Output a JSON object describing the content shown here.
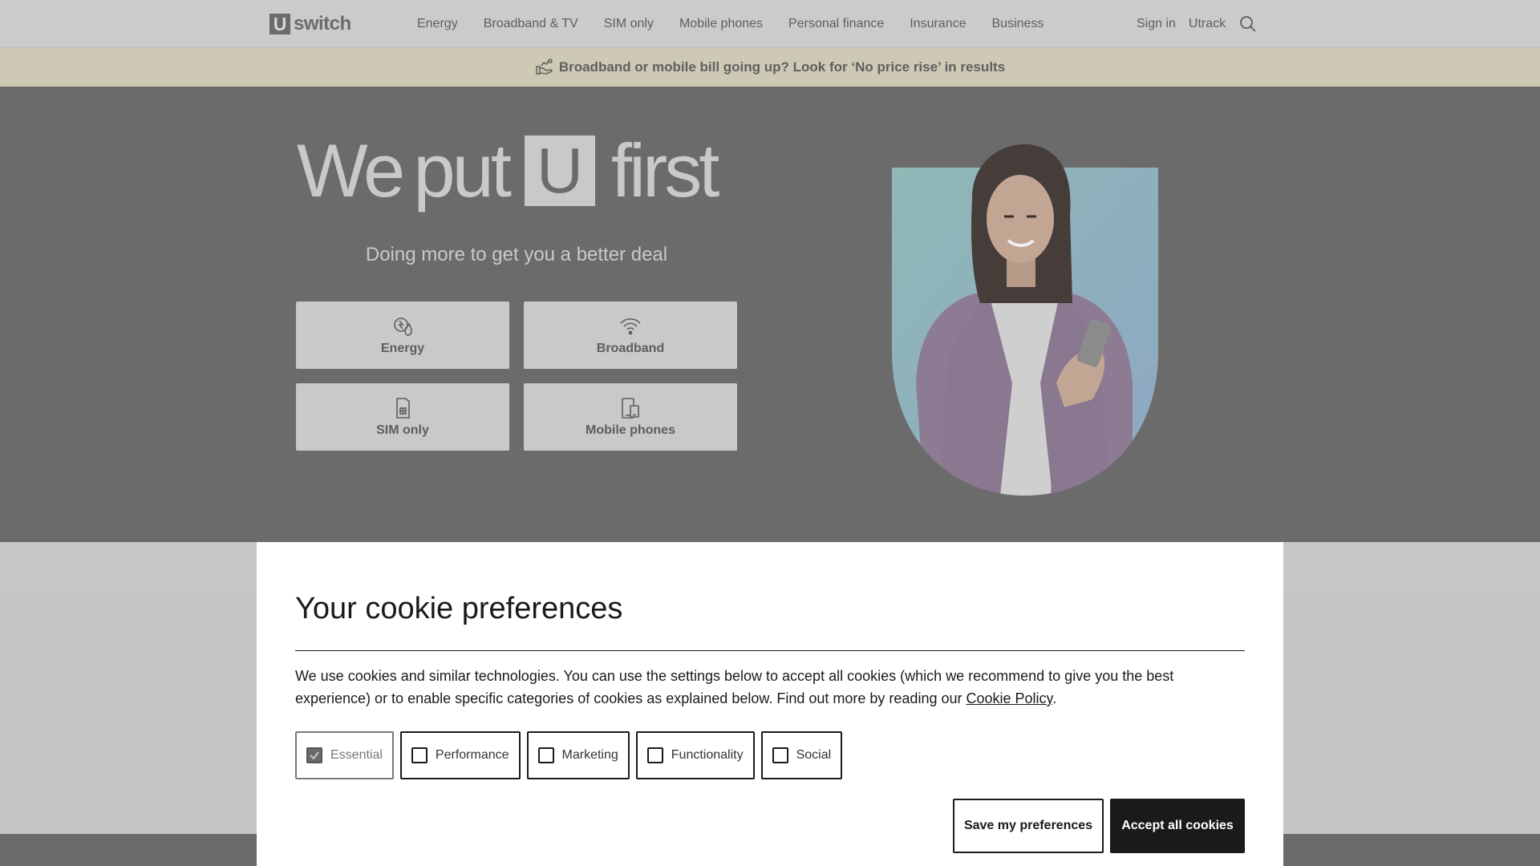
{
  "header": {
    "logo_box": "U",
    "logo_text": "switch",
    "nav": [
      "Energy",
      "Broadband & TV",
      "SIM only",
      "Mobile phones",
      "Personal finance",
      "Insurance",
      "Business"
    ],
    "sign_in": "Sign in",
    "utrack": "Utrack",
    "search_icon": "search-icon"
  },
  "banner": {
    "icon": "price-rise-hand-icon",
    "text": "Broadband or mobile bill going up? Look for ‘No price rise’ in results"
  },
  "hero": {
    "title_part1": "We",
    "title_part2": "put",
    "title_badge": "U",
    "title_part3": "first",
    "subtitle": "Doing more to get you a better deal",
    "tiles": [
      {
        "label": "Energy",
        "icon": "energy-icon"
      },
      {
        "label": "Broadband",
        "icon": "wifi-icon"
      },
      {
        "label": "SIM only",
        "icon": "sim-card-icon"
      },
      {
        "label": "Mobile phones",
        "icon": "mobile-phone-icon"
      }
    ]
  },
  "cookie": {
    "title": "Your cookie preferences",
    "text_before_link": "We use cookies and similar technologies. You can use the settings below to accept all cookies (which we recommend to give you the best experience) or to enable specific categories of cookies as explained below. Find out more by reading our ",
    "link": "Cookie Policy",
    "text_after_link": ".",
    "options": [
      {
        "label": "Essential",
        "checked": true,
        "disabled": true
      },
      {
        "label": "Performance",
        "checked": false,
        "disabled": false
      },
      {
        "label": "Marketing",
        "checked": false,
        "disabled": false
      },
      {
        "label": "Functionality",
        "checked": false,
        "disabled": false
      },
      {
        "label": "Social",
        "checked": false,
        "disabled": false
      }
    ],
    "save_label": "Save my preferences",
    "accept_label": "Accept all cookies"
  },
  "colors": {
    "overlay_dark": "#6b6b6b",
    "overlay_light": "#c9c9c9",
    "banner_bg": "#cdc9b5",
    "modal_bg": "#ffffff",
    "text_dark": "#1a1a1a"
  }
}
